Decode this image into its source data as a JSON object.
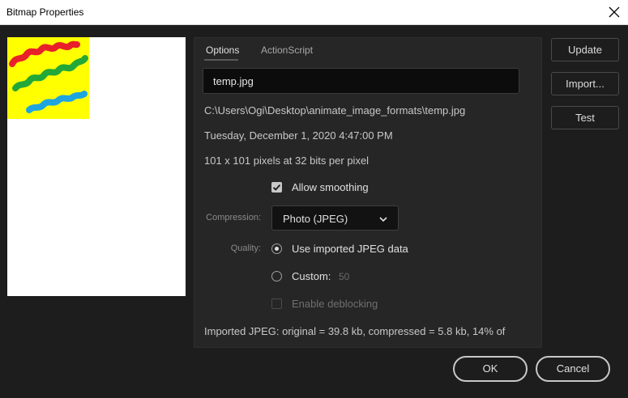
{
  "window": {
    "title": "Bitmap Properties"
  },
  "tabs": {
    "options": "Options",
    "actionscript": "ActionScript"
  },
  "name_field": {
    "value": "temp.jpg"
  },
  "info": {
    "path": "C:\\Users\\Ogi\\Desktop\\animate_image_formats\\temp.jpg",
    "date": "Tuesday, December 1, 2020  4:47:00 PM",
    "dimensions": "101 x 101 pixels at 32 bits per pixel"
  },
  "smoothing": {
    "label": "Allow smoothing",
    "checked": true
  },
  "compression": {
    "label": "Compression:",
    "value": "Photo (JPEG)"
  },
  "quality": {
    "label": "Quality:",
    "imported_label": "Use imported JPEG data",
    "custom_label": "Custom:",
    "custom_value": "50",
    "selected": "imported"
  },
  "deblocking": {
    "label": "Enable deblocking",
    "checked": false
  },
  "summary": "Imported JPEG: original = 39.8 kb, compressed = 5.8 kb, 14% of",
  "buttons": {
    "update": "Update",
    "import": "Import...",
    "test": "Test",
    "ok": "OK",
    "cancel": "Cancel"
  },
  "colors": {
    "background": "#1d1d1d",
    "panel": "#262626",
    "preview_bg": "#ffff00",
    "stroke_red": "#e8202a",
    "stroke_green": "#22a838",
    "stroke_blue": "#1ea5e0"
  }
}
